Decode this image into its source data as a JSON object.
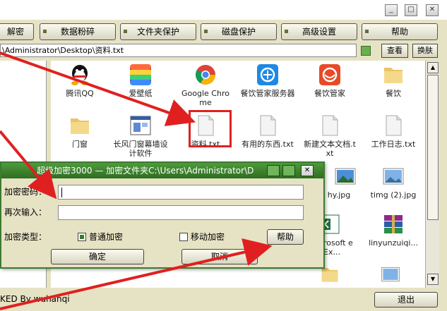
{
  "toolbar": {
    "buttons": [
      {
        "label": "解密"
      },
      {
        "label": "数据粉碎"
      },
      {
        "label": "文件夹保护"
      },
      {
        "label": "磁盘保护"
      },
      {
        "label": "高级设置"
      },
      {
        "label": "帮助"
      }
    ]
  },
  "address": {
    "path": "\\Administrator\\Desktop\\资料.txt",
    "view_button": "查看",
    "change_button": "换肤"
  },
  "files": [
    {
      "label": "腾讯QQ",
      "icon": "qq-icon"
    },
    {
      "label": "爱壁纸",
      "icon": "wallpaper-app-icon"
    },
    {
      "label": "Google Chrome",
      "icon": "chrome-icon"
    },
    {
      "label": "餐饮管家服务器",
      "icon": "restaurant-server-icon"
    },
    {
      "label": "餐饮管家",
      "icon": "restaurant-app-icon"
    },
    {
      "label": "餐饮",
      "icon": "folder-icon"
    },
    {
      "label": "门窗",
      "icon": "folder-icon"
    },
    {
      "label": "长风门窗幕墙设计软件",
      "icon": "app-window-icon"
    },
    {
      "label": "资料.txt",
      "icon": "txt-file-icon"
    },
    {
      "label": "有用的东西.txt",
      "icon": "txt-file-icon"
    },
    {
      "label": "新建文本文档.txt",
      "icon": "txt-file-icon"
    },
    {
      "label": "工作日志.txt",
      "icon": "txt-file-icon"
    },
    {
      "label": "hy.jpg",
      "icon": "image-file-icon"
    },
    {
      "label": "timg (2).jpg",
      "icon": "image-file-icon"
    },
    {
      "label": "rosoft e Ex...",
      "icon": "excel-icon"
    },
    {
      "label": "linyunzuiqi...",
      "icon": "rar-archive-icon"
    }
  ],
  "status": {
    "text": "KED By wuhanqi",
    "exit_button": "退出"
  },
  "dialog": {
    "title": "超级加密3000 — 加密文件夹C:\\Users\\Administrator\\D",
    "password_label": "加密密码：",
    "password_value": "",
    "confirm_label": "再次输入：",
    "confirm_value": "",
    "type_label": "加密类型：",
    "type_normal": "普通加密",
    "type_mobile": "移动加密",
    "help_button": "帮助",
    "ok_button": "确定",
    "cancel_button": "取消",
    "close_glyph": "✕"
  },
  "window": {
    "close_glyph": "✕",
    "minimize_glyph": "_",
    "maximize_glyph": "□"
  },
  "colors": {
    "dialog_title_bg": "#3c7a2e",
    "highlight": "#e02020",
    "window_bg": "#e6e2c4"
  }
}
